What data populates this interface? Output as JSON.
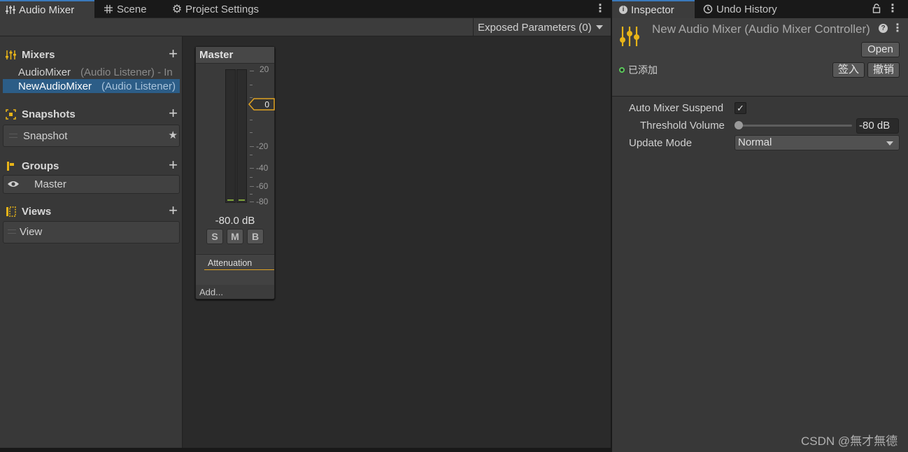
{
  "left_tabs": [
    {
      "label": "Audio Mixer",
      "icon": "mixer-sliders-icon"
    },
    {
      "label": "Scene",
      "icon": "grid-icon"
    },
    {
      "label": "Project Settings",
      "icon": "gear-icon"
    }
  ],
  "toolbar": {
    "exposed_parameters": "Exposed Parameters (0)"
  },
  "sidebar": {
    "mixers": {
      "title": "Mixers",
      "items": [
        {
          "name": "AudioMixer",
          "sub": "(Audio Listener) - In"
        },
        {
          "name": "NewAudioMixer",
          "sub": "(Audio Listener)"
        }
      ]
    },
    "snapshots": {
      "title": "Snapshots",
      "items": [
        "Snapshot"
      ]
    },
    "groups": {
      "title": "Groups",
      "items": [
        "Master"
      ]
    },
    "views": {
      "title": "Views",
      "items": [
        "View"
      ]
    }
  },
  "strip": {
    "title": "Master",
    "scale": [
      "20",
      "0",
      "-20",
      "-40",
      "-60",
      "-80"
    ],
    "fader_value": "0",
    "db_readout": "-80.0 dB",
    "buttons": {
      "solo": "S",
      "mute": "M",
      "bypass": "B"
    },
    "effect": "Attenuation",
    "add": "Add..."
  },
  "right_tabs": [
    {
      "label": "Inspector",
      "icon": "info-icon"
    },
    {
      "label": "Undo History",
      "icon": "history-icon"
    }
  ],
  "inspector": {
    "title": "New Audio Mixer (Audio Mixer Controller)",
    "open_button": "Open",
    "added_status": "已添加",
    "checkin_button": "签入",
    "revert_button": "撤销",
    "auto_mixer_suspend_label": "Auto Mixer Suspend",
    "auto_mixer_suspend_checked": "✓",
    "threshold_volume_label": "Threshold Volume",
    "threshold_volume_value": "-80 dB",
    "update_mode_label": "Update Mode",
    "update_mode_value": "Normal"
  },
  "watermark": "CSDN @無才無德",
  "colors": {
    "accent_selection": "#2c5d87",
    "fader_highlight": "#e0a223",
    "meter_level": "#7ea33a",
    "status_green": "#5ac85a",
    "mixer_icon": "#e8b418"
  }
}
